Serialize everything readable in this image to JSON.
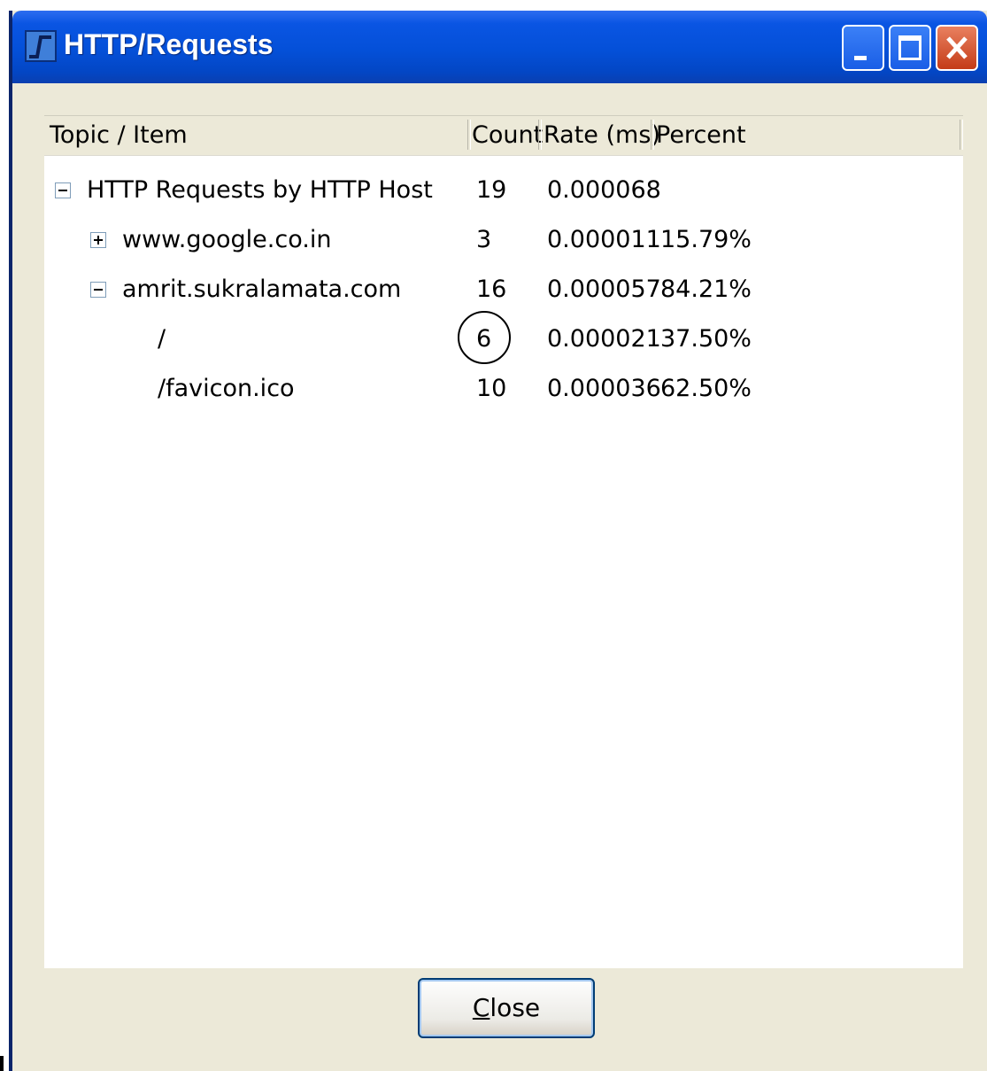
{
  "window": {
    "title": "HTTP/Requests",
    "icon": "app-graph-icon",
    "controls": [
      "minimize-icon",
      "maximize-icon",
      "close-icon"
    ]
  },
  "table": {
    "columns": [
      "Topic / Item",
      "Count",
      "Rate (ms)",
      "Percent"
    ],
    "rows": [
      {
        "level": 0,
        "toggle": "collapse",
        "topic": "HTTP Requests by HTTP Host",
        "count": "19",
        "rate": "0.000068",
        "percent": ""
      },
      {
        "level": 1,
        "toggle": "expand",
        "topic": "www.google.co.in",
        "count": "3",
        "rate": "0.000011",
        "percent": "15.79%"
      },
      {
        "level": 1,
        "toggle": "collapse",
        "topic": "amrit.sukralamata.com",
        "count": "16",
        "rate": "0.000057",
        "percent": "84.21%"
      },
      {
        "level": 2,
        "toggle": "",
        "topic": "/",
        "count": "6",
        "rate": "0.000021",
        "percent": "37.50%",
        "circled_count": true
      },
      {
        "level": 2,
        "toggle": "",
        "topic": "/favicon.ico",
        "count": "10",
        "rate": "0.000036",
        "percent": "62.50%"
      }
    ]
  },
  "close_button": {
    "mnemonic": "C",
    "rest": "lose"
  },
  "colors": {
    "titlebar": "#0450d8",
    "window_bg": "#ece9d8",
    "close_red": "#c43c18"
  }
}
